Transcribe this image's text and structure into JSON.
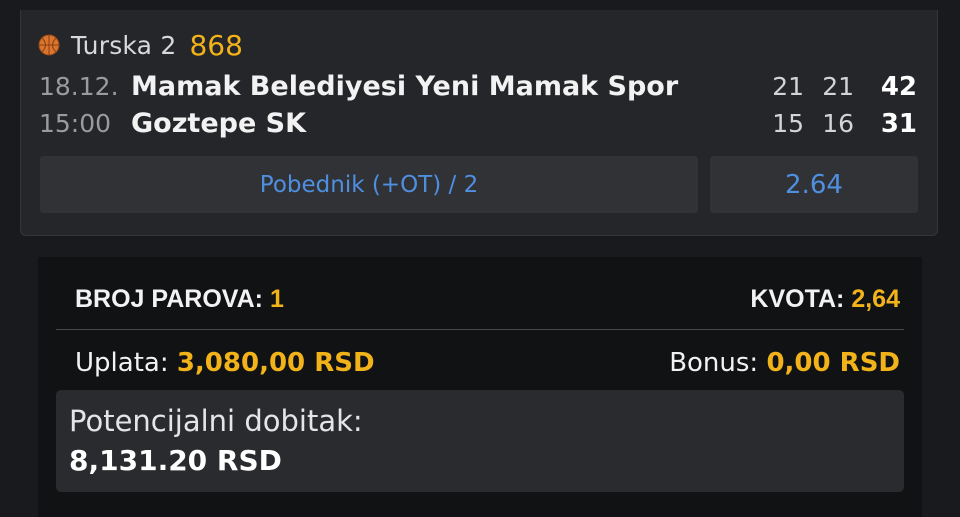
{
  "event": {
    "sport_icon": "basketball-icon",
    "league": "Turska 2",
    "code": "868",
    "date": "18.12.",
    "time": "15:00",
    "home_team": "Mamak Belediyesi Yeni Mamak Spor",
    "away_team": "Goztepe SK",
    "home_scores": [
      "21",
      "21",
      "42"
    ],
    "away_scores": [
      "15",
      "16",
      "31"
    ],
    "market": "Pobednik (+OT) / 2",
    "odd": "2.64"
  },
  "slip": {
    "pairs_label": "BROJ PAROVA:",
    "pairs_value": "1",
    "odds_label": "KVOTA:",
    "odds_value": "2,64",
    "stake_label": "Uplata:",
    "stake_value": "3,080,00 RSD",
    "bonus_label": "Bonus:",
    "bonus_value": "0,00 RSD",
    "potential_label": "Potencijalni dobitak:",
    "potential_value": "8,131.20 RSD"
  },
  "colors": {
    "accent_yellow": "#f2b21a",
    "link_blue": "#4f8fe0",
    "ball_orange": "#d9752e"
  }
}
